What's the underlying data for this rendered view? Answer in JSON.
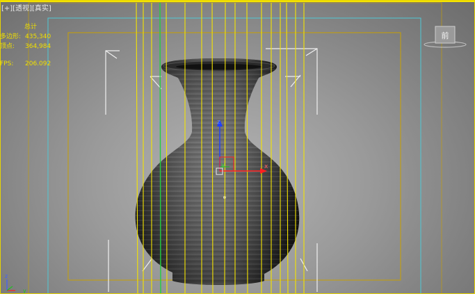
{
  "viewport": {
    "labels": {
      "menu": "[+]",
      "view": "[透视]",
      "shading": "[真实]"
    },
    "stats": {
      "total_label": "总计",
      "polys_label": "多边形:",
      "polys_value": "435,340",
      "verts_label": "顶点:",
      "verts_value": "364,984",
      "fps_label": "FPS:",
      "fps_value": "206.092"
    },
    "viewcube": {
      "face_label": "前"
    },
    "colors": {
      "border": "#f5e400",
      "stats_text": "#f0e000",
      "safe_frame_cyan": "#4ec9d6",
      "safe_frame_gold": "#c8a000",
      "gizmo_x": "#ff2020",
      "gizmo_y": "#20c020",
      "gizmo_z": "#2040ff"
    }
  }
}
